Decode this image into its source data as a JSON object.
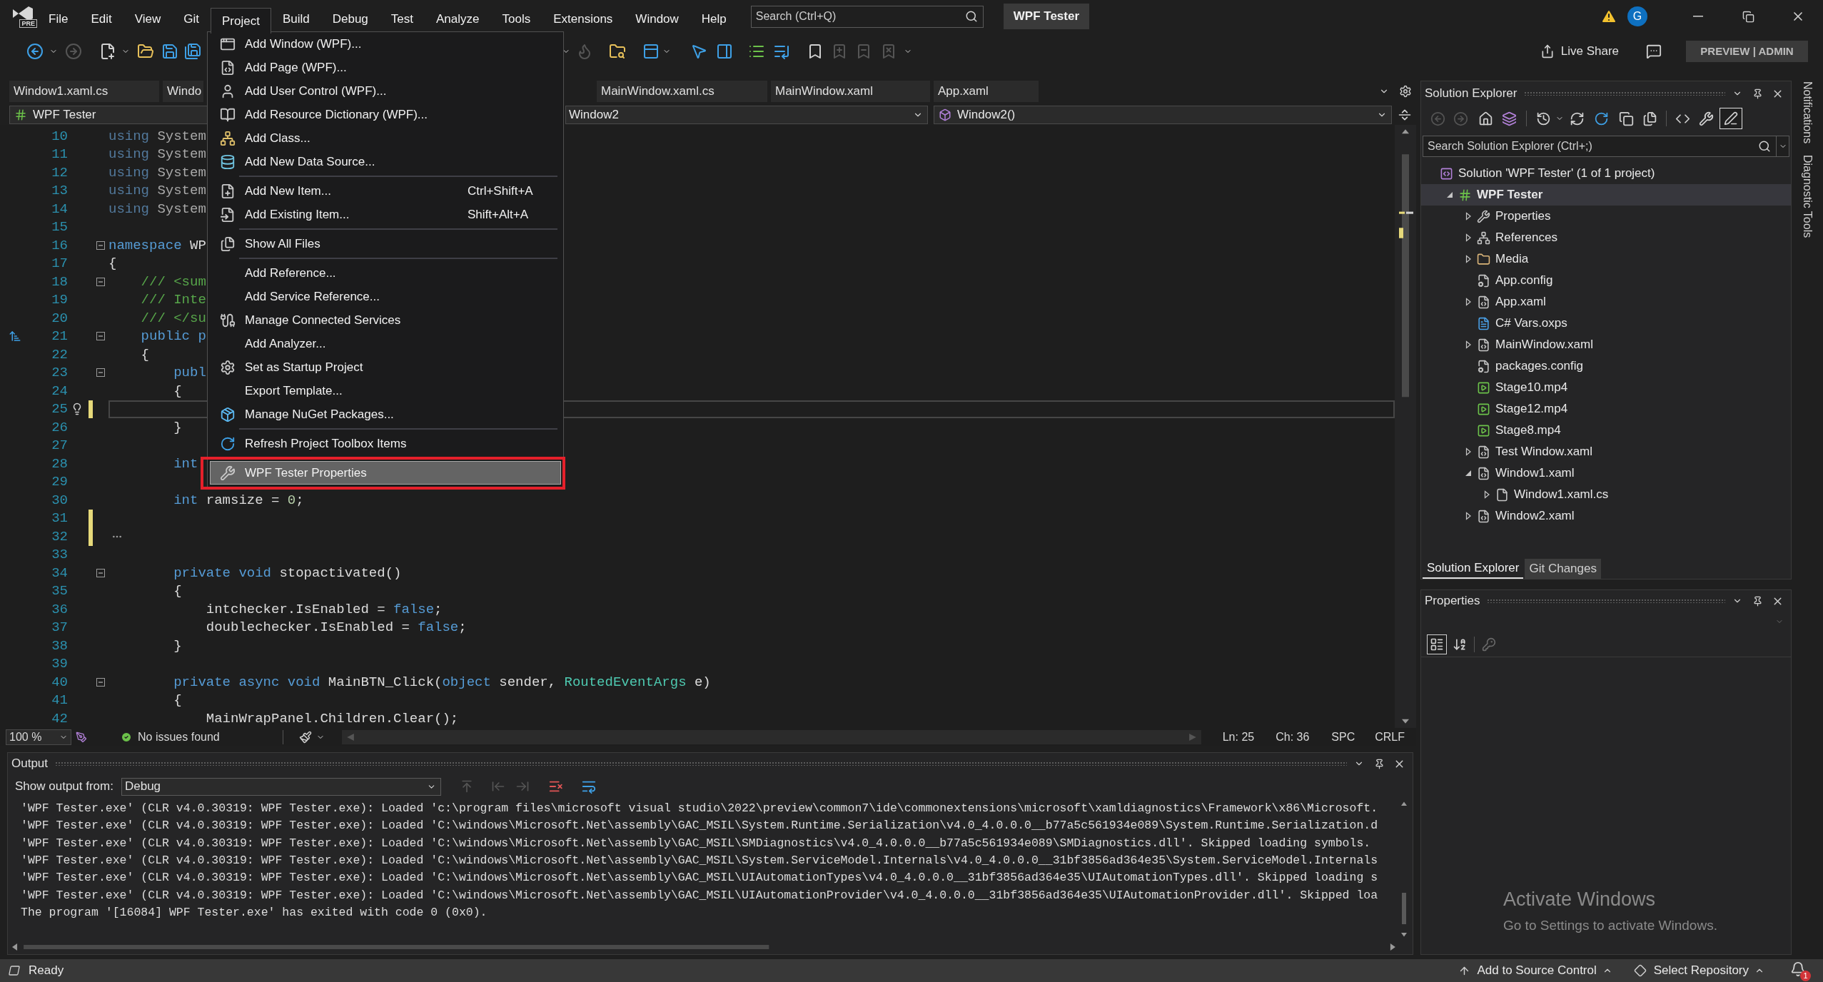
{
  "menu_bar": {
    "logo_badge": "PRE",
    "items": [
      {
        "label": "File",
        "selected": false
      },
      {
        "label": "Edit",
        "selected": false
      },
      {
        "label": "View",
        "selected": false
      },
      {
        "label": "Git",
        "selected": false
      },
      {
        "label": "Project",
        "selected": true
      },
      {
        "label": "Build",
        "selected": false
      },
      {
        "label": "Debug",
        "selected": false
      },
      {
        "label": "Test",
        "selected": false
      },
      {
        "label": "Analyze",
        "selected": false
      },
      {
        "label": "Tools",
        "selected": false
      },
      {
        "label": "Extensions",
        "selected": false
      },
      {
        "label": "Window",
        "selected": false
      },
      {
        "label": "Help",
        "selected": false
      }
    ],
    "search": {
      "placeholder": "Search (Ctrl+Q)"
    },
    "solution_name": "WPF Tester",
    "account_initial": "G"
  },
  "toolbar": {
    "live_share": "Live Share",
    "edition_badge": "PREVIEW | ADMIN"
  },
  "project_menu": {
    "groups": [
      [
        {
          "kind": "window",
          "label": "Add Window (WPF)...",
          "selected": false
        },
        {
          "kind": "page",
          "label": "Add Page (WPF)...",
          "selected": false
        },
        {
          "kind": "user_control",
          "label": "Add User Control (WPF)...",
          "selected": false
        },
        {
          "kind": "resource_dictionary",
          "label": "Add Resource Dictionary (WPF)...",
          "selected": false
        },
        {
          "kind": "class",
          "label": "Add Class...",
          "selected": false
        },
        {
          "kind": "data_source",
          "label": "Add New Data Source...",
          "selected": false
        }
      ],
      [
        {
          "kind": "new_item",
          "label": "Add New Item...",
          "shortcut": "Ctrl+Shift+A",
          "selected": false
        },
        {
          "kind": "existing_item",
          "label": "Add Existing Item...",
          "shortcut": "Shift+Alt+A",
          "selected": false
        }
      ],
      [
        {
          "kind": "show_all_files",
          "label": "Show All Files",
          "selected": false
        }
      ],
      [
        {
          "kind": "plain",
          "label": "Add Reference...",
          "selected": false
        },
        {
          "kind": "plain",
          "label": "Add Service Reference...",
          "selected": false
        },
        {
          "kind": "connected_services",
          "label": "Manage Connected Services",
          "selected": false
        },
        {
          "kind": "plain",
          "label": "Add Analyzer...",
          "selected": false
        },
        {
          "kind": "settings",
          "label": "Set as Startup Project",
          "selected": false
        },
        {
          "kind": "plain",
          "label": "Export Template...",
          "selected": false
        },
        {
          "kind": "nuget",
          "label": "Manage NuGet Packages...",
          "selected": false
        }
      ],
      [
        {
          "kind": "refresh",
          "label": "Refresh Project Toolbox Items",
          "selected": false
        }
      ],
      [
        {
          "kind": "wrench",
          "label": "WPF Tester Properties",
          "selected": true
        }
      ]
    ]
  },
  "document_tabs": [
    {
      "label": "Window1.xaml.cs",
      "selected": false
    },
    {
      "label": "Windo",
      "selected": false
    },
    {
      "label": "MainWindow.xaml.cs",
      "selected": false
    },
    {
      "label": "MainWindow.xaml",
      "selected": false
    },
    {
      "label": "App.xaml",
      "selected": false
    }
  ],
  "navigation_bar": {
    "project": "WPF Tester",
    "type": "Window2",
    "member": "Window2()"
  },
  "editor": {
    "lines": [
      {
        "kind": "code",
        "number": "10",
        "tokens": [
          {
            "kind": "faded_keyword",
            "text": "using"
          },
          {
            "kind": "faded",
            "text": " System"
          }
        ],
        "current": false,
        "changed": false,
        "fold": false
      },
      {
        "kind": "code",
        "number": "11",
        "tokens": [
          {
            "kind": "faded_keyword",
            "text": "using"
          },
          {
            "kind": "faded",
            "text": " System"
          }
        ],
        "current": false,
        "changed": false,
        "fold": false
      },
      {
        "kind": "code",
        "number": "12",
        "tokens": [
          {
            "kind": "faded_keyword",
            "text": "using"
          },
          {
            "kind": "faded",
            "text": " System"
          }
        ],
        "current": false,
        "changed": false,
        "fold": false
      },
      {
        "kind": "code",
        "number": "13",
        "tokens": [
          {
            "kind": "faded_keyword",
            "text": "using"
          },
          {
            "kind": "faded",
            "text": " System"
          }
        ],
        "current": false,
        "changed": false,
        "fold": false
      },
      {
        "kind": "code",
        "number": "14",
        "tokens": [
          {
            "kind": "faded_keyword",
            "text": "using"
          },
          {
            "kind": "faded",
            "text": " System"
          }
        ],
        "current": false,
        "changed": false,
        "fold": false
      },
      {
        "kind": "code",
        "number": "15",
        "current": false,
        "changed": false,
        "fold": false
      },
      {
        "kind": "code",
        "number": "16",
        "tokens": [
          {
            "kind": "keyword",
            "text": "namespace"
          },
          {
            "kind": "plain",
            "text": " WP"
          }
        ],
        "current": false,
        "changed": false,
        "fold": true
      },
      {
        "kind": "code",
        "number": "17",
        "tokens": [
          {
            "kind": "plain",
            "text": "{"
          }
        ],
        "current": false,
        "changed": false,
        "fold": false
      },
      {
        "kind": "code",
        "number": "18",
        "tokens": [
          {
            "kind": "comment",
            "text": "    /// <sum"
          }
        ],
        "current": false,
        "changed": false,
        "fold": true
      },
      {
        "kind": "code",
        "number": "19",
        "tokens": [
          {
            "kind": "comment",
            "text": "    /// Inte"
          }
        ],
        "current": false,
        "changed": false,
        "fold": false
      },
      {
        "kind": "code",
        "number": "20",
        "tokens": [
          {
            "kind": "comment",
            "text": "    /// </su"
          }
        ],
        "current": false,
        "changed": false,
        "fold": false
      },
      {
        "kind": "sort_glyph",
        "number": "21",
        "tokens": [
          {
            "kind": "keyword",
            "text": "    public p"
          }
        ],
        "current": false,
        "changed": false,
        "fold": true
      },
      {
        "kind": "code",
        "number": "22",
        "tokens": [
          {
            "kind": "plain",
            "text": "    {"
          }
        ],
        "current": false,
        "changed": false,
        "fold": false
      },
      {
        "kind": "code",
        "number": "23",
        "tokens": [
          {
            "kind": "keyword",
            "text": "        publ"
          }
        ],
        "current": false,
        "changed": false,
        "fold": true
      },
      {
        "kind": "code",
        "number": "24",
        "tokens": [
          {
            "kind": "plain",
            "text": "        {"
          }
        ],
        "current": false,
        "changed": false,
        "fold": false
      },
      {
        "kind": "lightbulb",
        "number": "25",
        "current": true,
        "changed": true,
        "fold": false
      },
      {
        "kind": "code",
        "number": "26",
        "tokens": [
          {
            "kind": "plain",
            "text": "        }"
          }
        ],
        "current": false,
        "changed": false,
        "fold": false
      },
      {
        "kind": "code",
        "number": "27",
        "current": false,
        "changed": false,
        "fold": false
      },
      {
        "kind": "code",
        "number": "28",
        "tokens": [
          {
            "kind": "keyword",
            "text": "        int"
          }
        ],
        "current": false,
        "changed": false,
        "fold": false
      },
      {
        "kind": "code",
        "number": "29",
        "current": false,
        "changed": false,
        "fold": false
      },
      {
        "kind": "code",
        "number": "30",
        "tokens": [
          {
            "kind": "keyword",
            "text": "        int"
          },
          {
            "kind": "plain",
            "text": " ramsize = "
          },
          {
            "kind": "number",
            "text": "0"
          },
          {
            "kind": "plain",
            "text": ";"
          }
        ],
        "current": false,
        "changed": false,
        "fold": false
      },
      {
        "kind": "code",
        "number": "31",
        "current": false,
        "changed": true,
        "fold": false
      },
      {
        "kind": "collapsed_hint",
        "number": "32",
        "current": false,
        "changed": true,
        "fold": false
      },
      {
        "kind": "code",
        "number": "33",
        "current": false,
        "changed": false,
        "fold": false
      },
      {
        "kind": "code",
        "number": "34",
        "tokens": [
          {
            "kind": "keyword",
            "text": "        private void"
          },
          {
            "kind": "plain",
            "text": " stopactivated()"
          }
        ],
        "current": false,
        "changed": false,
        "fold": true
      },
      {
        "kind": "code",
        "number": "35",
        "tokens": [
          {
            "kind": "plain",
            "text": "        {"
          }
        ],
        "current": false,
        "changed": false,
        "fold": false
      },
      {
        "kind": "code",
        "number": "36",
        "tokens": [
          {
            "kind": "plain",
            "text": "            intchecker.IsEnabled = "
          },
          {
            "kind": "keyword",
            "text": "false"
          },
          {
            "kind": "plain",
            "text": ";"
          }
        ],
        "current": false,
        "changed": false,
        "fold": false
      },
      {
        "kind": "code",
        "number": "37",
        "tokens": [
          {
            "kind": "plain",
            "text": "            doublechecker.IsEnabled = "
          },
          {
            "kind": "keyword",
            "text": "false"
          },
          {
            "kind": "plain",
            "text": ";"
          }
        ],
        "current": false,
        "changed": false,
        "fold": false
      },
      {
        "kind": "code",
        "number": "38",
        "tokens": [
          {
            "kind": "plain",
            "text": "        }"
          }
        ],
        "current": false,
        "changed": false,
        "fold": false
      },
      {
        "kind": "code",
        "number": "39",
        "current": false,
        "changed": false,
        "fold": false
      },
      {
        "kind": "code",
        "number": "40",
        "tokens": [
          {
            "kind": "keyword",
            "text": "        private async void"
          },
          {
            "kind": "plain",
            "text": " MainBTN_Click("
          },
          {
            "kind": "keyword",
            "text": "object"
          },
          {
            "kind": "plain",
            "text": " sender, "
          },
          {
            "kind": "type",
            "text": "RoutedEventArgs"
          },
          {
            "kind": "plain",
            "text": " e)"
          }
        ],
        "current": false,
        "changed": false,
        "fold": true
      },
      {
        "kind": "code",
        "number": "41",
        "tokens": [
          {
            "kind": "plain",
            "text": "        {"
          }
        ],
        "current": false,
        "changed": false,
        "fold": false
      },
      {
        "kind": "code",
        "number": "42",
        "tokens": [
          {
            "kind": "plain",
            "text": "            MainWrapPanel.Children.Clear();"
          }
        ],
        "current": false,
        "changed": false,
        "fold": false
      }
    ]
  },
  "editor_status": {
    "zoom": "100 %",
    "issues": "No issues found",
    "line": "Ln: 25",
    "column": "Ch: 36",
    "whitespace": "SPC",
    "line_ending": "CRLF"
  },
  "output": {
    "title": "Output",
    "source_label": "Show output from:",
    "source": "Debug",
    "lines": [
      "'WPF Tester.exe' (CLR v4.0.30319: WPF Tester.exe): Loaded 'c:\\program files\\microsoft visual studio\\2022\\preview\\common7\\ide\\commonextensions\\microsoft\\xamldiagnostics\\Framework\\x86\\Microsoft.",
      "'WPF Tester.exe' (CLR v4.0.30319: WPF Tester.exe): Loaded 'C:\\windows\\Microsoft.Net\\assembly\\GAC_MSIL\\System.Runtime.Serialization\\v4.0_4.0.0.0__b77a5c561934e089\\System.Runtime.Serialization.d",
      "'WPF Tester.exe' (CLR v4.0.30319: WPF Tester.exe): Loaded 'C:\\windows\\Microsoft.Net\\assembly\\GAC_MSIL\\SMDiagnostics\\v4.0_4.0.0.0__b77a5c561934e089\\SMDiagnostics.dll'. Skipped loading symbols.",
      "'WPF Tester.exe' (CLR v4.0.30319: WPF Tester.exe): Loaded 'C:\\windows\\Microsoft.Net\\assembly\\GAC_MSIL\\System.ServiceModel.Internals\\v4.0_4.0.0.0__31bf3856ad364e35\\System.ServiceModel.Internals",
      "'WPF Tester.exe' (CLR v4.0.30319: WPF Tester.exe): Loaded 'C:\\windows\\Microsoft.Net\\assembly\\GAC_MSIL\\UIAutomationTypes\\v4.0_4.0.0.0__31bf3856ad364e35\\UIAutomationTypes.dll'. Skipped loading s",
      "'WPF Tester.exe' (CLR v4.0.30319: WPF Tester.exe): Loaded 'C:\\windows\\Microsoft.Net\\assembly\\GAC_MSIL\\UIAutomationProvider\\v4.0_4.0.0.0__31bf3856ad364e35\\UIAutomationProvider.dll'. Skipped loa",
      "The program '[16084] WPF Tester.exe' has exited with code 0 (0x0)."
    ]
  },
  "solution_explorer": {
    "title": "Solution Explorer",
    "preview_toggle": {
      "on": true
    },
    "search": {
      "placeholder": "Search Solution Explorer (Ctrl+;)"
    },
    "tree": [
      {
        "kind": "solution",
        "label": "Solution 'WPF Tester' (1 of 1 project)",
        "selected": false,
        "children": [
          {
            "kind": "project",
            "label": "WPF Tester",
            "selected": true,
            "expanded": true,
            "children": [
              {
                "kind": "properties",
                "label": "Properties",
                "selected": false,
                "expanded": false
              },
              {
                "kind": "references",
                "label": "References",
                "selected": false,
                "expanded": false
              },
              {
                "kind": "folder",
                "label": "Media",
                "selected": false,
                "expanded": false
              },
              {
                "kind": "config",
                "label": "App.config",
                "selected": false
              },
              {
                "kind": "xaml",
                "label": "App.xaml",
                "selected": false,
                "expanded": false
              },
              {
                "kind": "document",
                "label": "C# Vars.oxps",
                "selected": false
              },
              {
                "kind": "xaml",
                "label": "MainWindow.xaml",
                "selected": false,
                "expanded": false
              },
              {
                "kind": "config",
                "label": "packages.config",
                "selected": false
              },
              {
                "kind": "video",
                "label": "Stage10.mp4",
                "selected": false
              },
              {
                "kind": "video",
                "label": "Stage12.mp4",
                "selected": false
              },
              {
                "kind": "video",
                "label": "Stage8.mp4",
                "selected": false
              },
              {
                "kind": "xaml",
                "label": "Test Window.xaml",
                "selected": false,
                "expanded": false
              },
              {
                "kind": "xaml",
                "label": "Window1.xaml",
                "selected": false,
                "expanded": true,
                "children": [
                  {
                    "kind": "code",
                    "label": "Window1.xaml.cs",
                    "selected": false,
                    "expanded": false
                  }
                ]
              },
              {
                "kind": "xaml",
                "label": "Window2.xaml",
                "selected": false,
                "expanded": false
              }
            ]
          }
        ]
      }
    ]
  },
  "explorer_tabs": [
    {
      "label": "Solution Explorer",
      "selected": true
    },
    {
      "label": "Git Changes",
      "selected": false
    }
  ],
  "properties": {
    "title": "Properties",
    "view_buttons": [
      {
        "kind": "categorized",
        "selected": true
      },
      {
        "kind": "alphabetical",
        "selected": false
      }
    ]
  },
  "side_tabs": [
    "Notifications",
    "Diagnostic Tools"
  ],
  "status_bar": {
    "status": "Ready",
    "source_control": "Add to Source Control",
    "repository": "Select Repository",
    "notification_count": "1"
  },
  "activation_notice": {
    "title": "Activate Windows",
    "subtitle": "Go to Settings to activate Windows."
  }
}
